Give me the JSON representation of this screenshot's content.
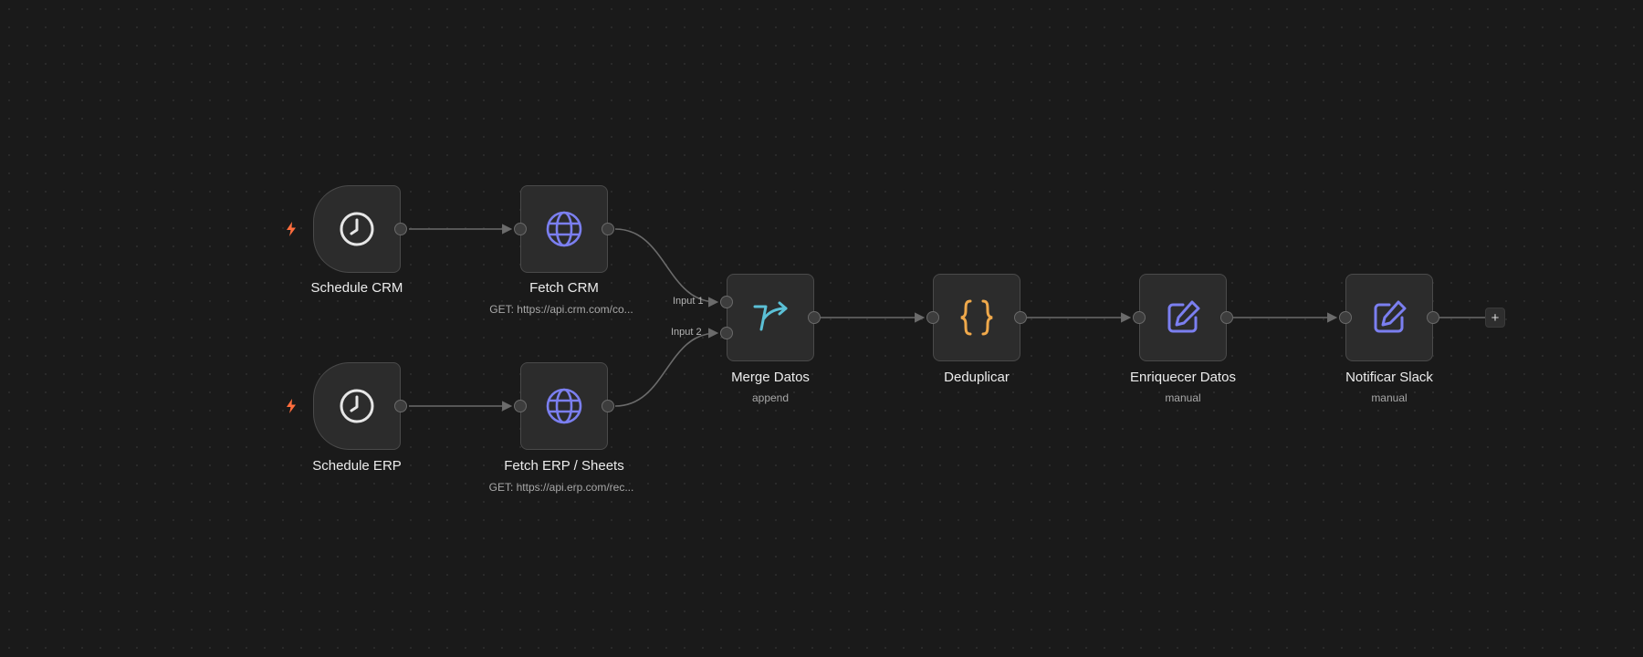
{
  "colors": {
    "background": "#1a1a1a",
    "node_fill": "#2c2c2c",
    "node_border": "#4a4a4a",
    "edge": "#6b6b6b",
    "trigger_bolt": "#ff6d3d",
    "http_icon": "#7b7ff0",
    "merge_icon": "#5bc0d6",
    "code_icon": "#f0a94b",
    "edit_icon": "#7b7ff0"
  },
  "nodes": {
    "schedule_crm": {
      "label": "Schedule CRM",
      "icon": "clock-icon"
    },
    "schedule_erp": {
      "label": "Schedule ERP",
      "icon": "clock-icon"
    },
    "fetch_crm": {
      "label": "Fetch CRM",
      "sublabel": "GET: https://api.crm.com/co...",
      "icon": "globe-icon"
    },
    "fetch_erp": {
      "label": "Fetch ERP / Sheets",
      "sublabel": "GET: https://api.erp.com/rec...",
      "icon": "globe-icon"
    },
    "merge": {
      "label": "Merge Datos",
      "sublabel": "append",
      "icon": "merge-icon",
      "input1": "Input 1",
      "input2": "Input 2"
    },
    "dedup": {
      "label": "Deduplicar",
      "icon": "braces-icon"
    },
    "enrich": {
      "label": "Enriquecer Datos",
      "sublabel": "manual",
      "icon": "edit-icon"
    },
    "notify": {
      "label": "Notificar Slack",
      "sublabel": "manual",
      "icon": "edit-icon"
    }
  },
  "add_button": {
    "label": "+"
  }
}
